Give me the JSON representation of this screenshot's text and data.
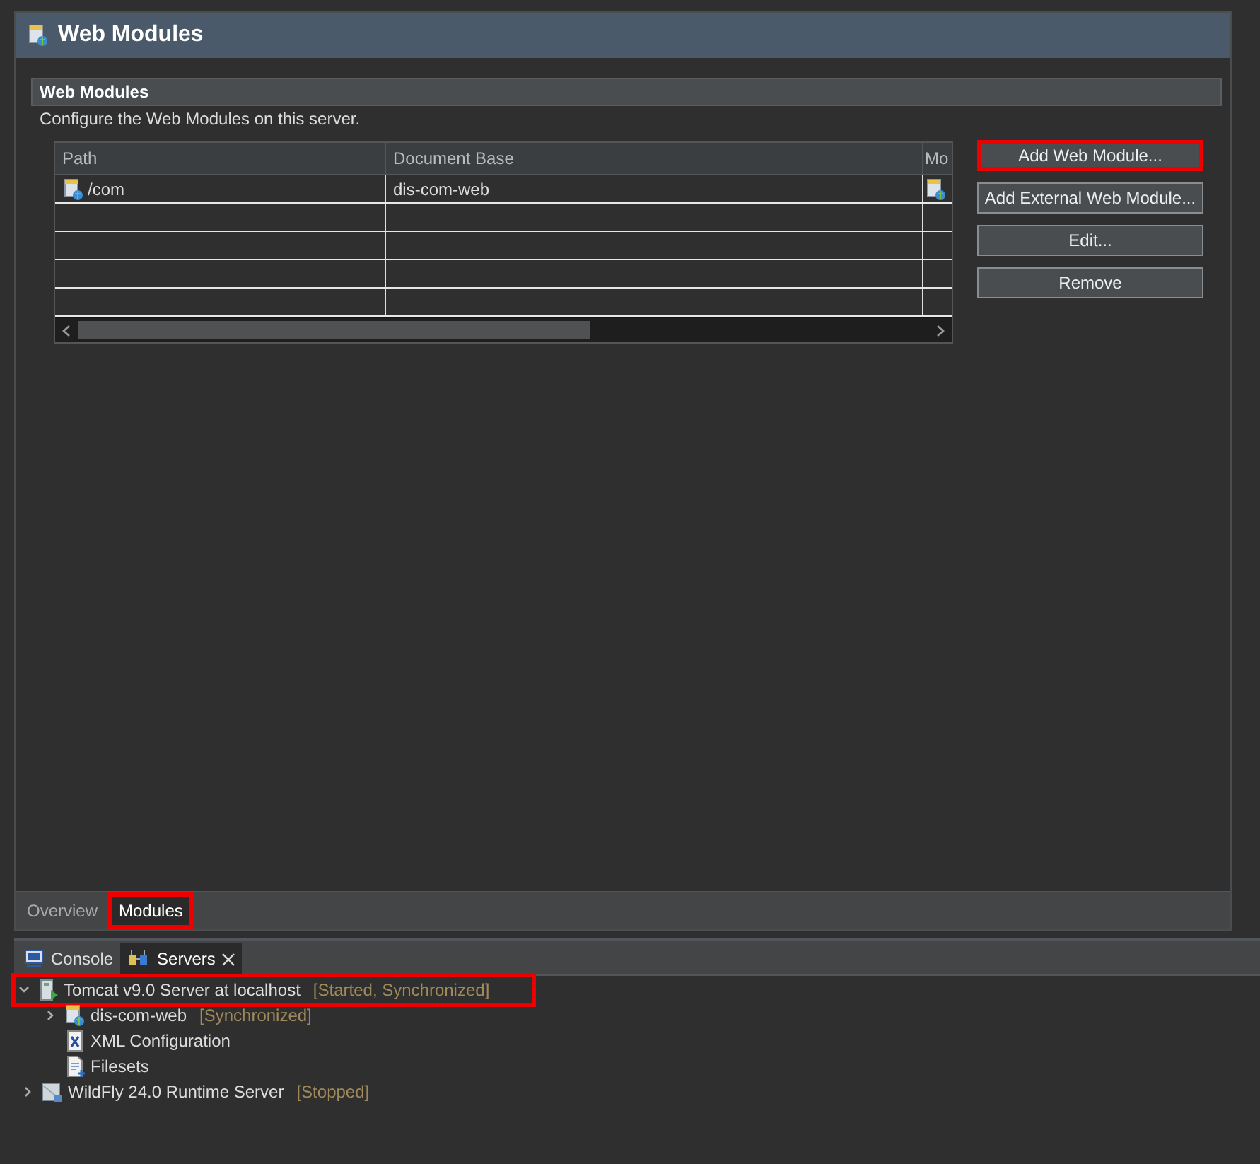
{
  "editor": {
    "title": "Web Modules",
    "section": {
      "title": "Web Modules",
      "description": "Configure the Web Modules on this server."
    },
    "table": {
      "columns": [
        "Path",
        "Document Base",
        "Mo"
      ],
      "rows": [
        {
          "cells": [
            "/com",
            "dis-com-web",
            ""
          ]
        },
        {
          "cells": [
            "",
            "",
            ""
          ]
        },
        {
          "cells": [
            "",
            "",
            ""
          ]
        },
        {
          "cells": [
            "",
            "",
            ""
          ]
        },
        {
          "cells": [
            "",
            "",
            ""
          ]
        }
      ]
    },
    "buttons": [
      {
        "label": "Add Web Module...",
        "highlighted": true
      },
      {
        "label": "Add External Web Module...",
        "highlighted": false
      },
      {
        "label": "Edit...",
        "highlighted": false
      },
      {
        "label": "Remove",
        "highlighted": false
      }
    ],
    "page_tabs": [
      {
        "label": "Overview",
        "selected": false,
        "highlighted": false
      },
      {
        "label": "Modules",
        "selected": true,
        "highlighted": true
      }
    ]
  },
  "servers_view": {
    "tabs": [
      {
        "label": "Console",
        "selected": false,
        "closable": false,
        "kind": "console"
      },
      {
        "label": "Servers",
        "selected": true,
        "closable": true,
        "kind": "servers"
      }
    ],
    "tree": [
      {
        "kind": "server",
        "label": "Tomcat v9.0 Server at localhost",
        "status": "[Started, Synchronized]",
        "expanded": true,
        "highlighted": true,
        "children": [
          {
            "kind": "module",
            "label": "dis-com-web",
            "status": "[Synchronized]",
            "expanded": false,
            "highlighted": false
          },
          {
            "kind": "config",
            "label": "XML Configuration",
            "highlighted": false
          },
          {
            "kind": "fileset",
            "label": "Filesets",
            "highlighted": false
          }
        ]
      },
      {
        "kind": "stopped-server",
        "label": "WildFly 24.0 Runtime Server",
        "status": "[Stopped]",
        "expanded": false,
        "highlighted": false
      }
    ]
  }
}
